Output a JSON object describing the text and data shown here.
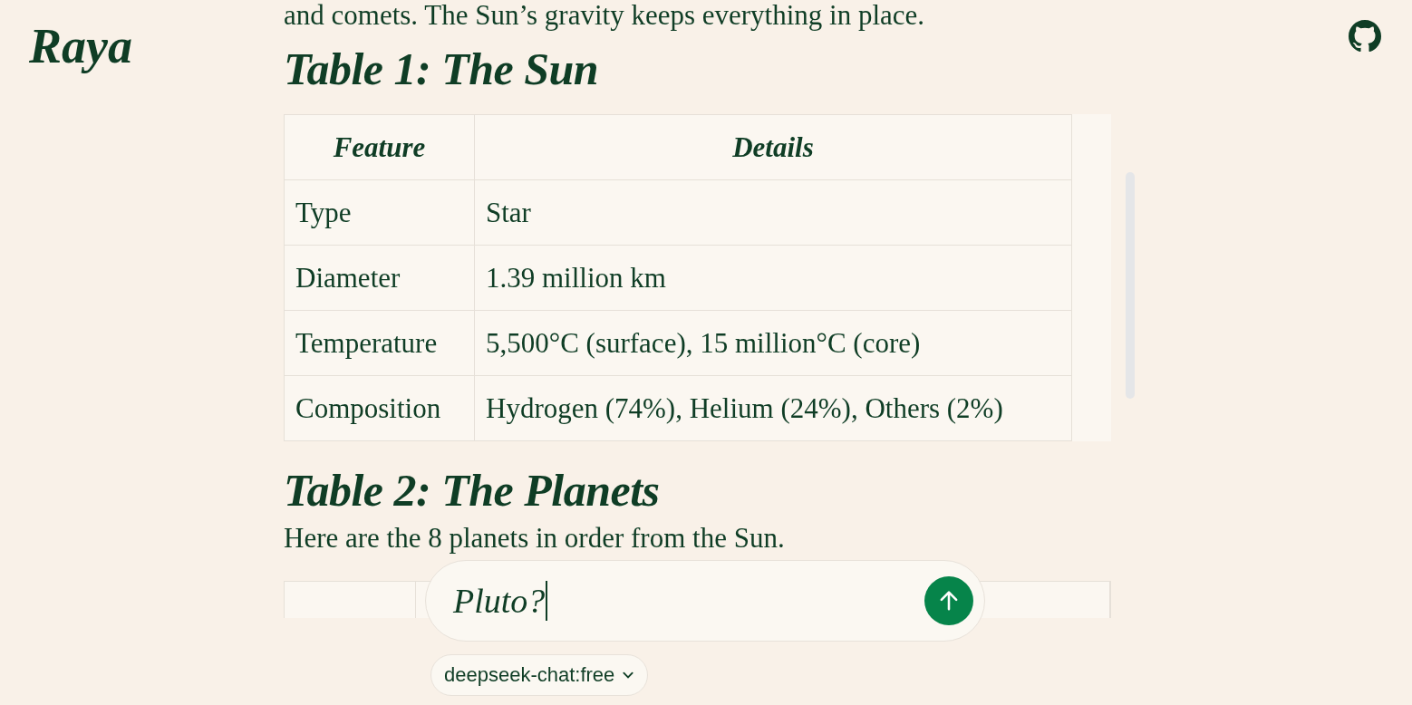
{
  "logo": "Raya",
  "content": [
    {
      "kind": "paragraph",
      "text": "and comets. The Sun’s gravity keeps everything in place."
    },
    {
      "kind": "heading",
      "text": "Table 1: The Sun"
    },
    {
      "kind": "table",
      "columns": [
        "Feature",
        "Details"
      ],
      "rows": [
        [
          "Type",
          "Star"
        ],
        [
          "Diameter",
          "1.39 million km"
        ],
        [
          "Temperature",
          "5,500°C (surface), 15 million°C (core)"
        ],
        [
          "Composition",
          "Hydrogen (74%), Helium (24%), Others (2%)"
        ]
      ]
    },
    {
      "kind": "heading",
      "text": "Table 2: The Planets"
    },
    {
      "kind": "paragraph",
      "text": "Here are the 8 planets in order from the Sun."
    },
    {
      "kind": "table-top"
    }
  ],
  "composer": {
    "value": "Pluto?",
    "model": "deepseek-chat:free"
  }
}
